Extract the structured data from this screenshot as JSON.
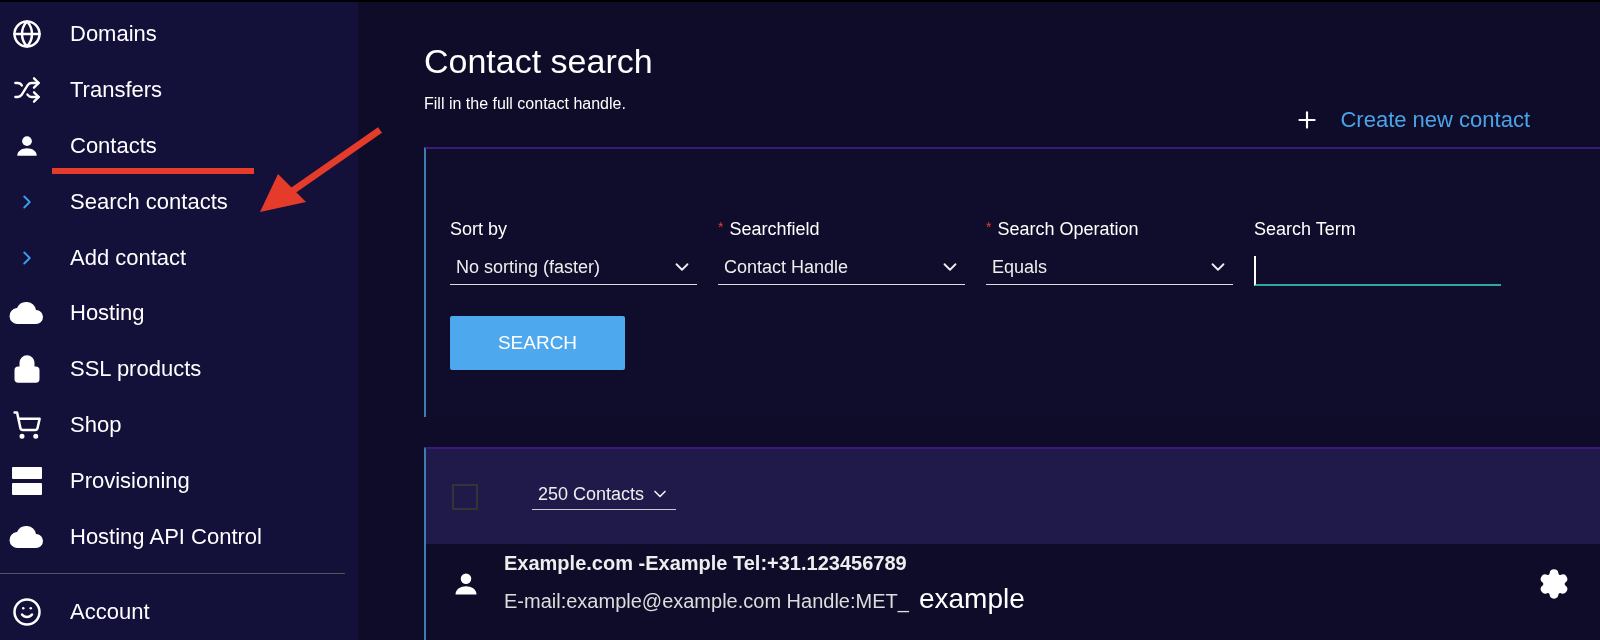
{
  "sidebar": {
    "items": [
      {
        "kind": "main",
        "label": "Domains",
        "underlined": false
      },
      {
        "kind": "main",
        "label": "Transfers",
        "underlined": false
      },
      {
        "kind": "main",
        "label": "Contacts",
        "underlined": true
      },
      {
        "kind": "sub",
        "label": "Search contacts",
        "underlined": false
      },
      {
        "kind": "sub",
        "label": "Add contact",
        "underlined": false
      },
      {
        "kind": "main",
        "label": "Hosting",
        "underlined": false
      },
      {
        "kind": "main",
        "label": "SSL products",
        "underlined": false
      },
      {
        "kind": "main",
        "label": "Shop",
        "underlined": false
      },
      {
        "kind": "main",
        "label": "Provisioning",
        "underlined": false
      },
      {
        "kind": "main",
        "label": "Hosting API Control",
        "underlined": false
      },
      {
        "kind": "divider"
      },
      {
        "kind": "main",
        "label": "Account",
        "underlined": false
      }
    ]
  },
  "page": {
    "title": "Contact search",
    "subtitle": "Fill in the full contact handle.",
    "create_link": "Create new contact"
  },
  "search_form": {
    "fields": [
      {
        "kind": "select",
        "label": "Sort by",
        "value": "No sorting (faster)"
      },
      {
        "kind": "select",
        "label": "Searchfield",
        "required_mark": "*",
        "value": "Contact Handle"
      },
      {
        "kind": "select",
        "label": "Search Operation",
        "required_mark": "*",
        "value": "Equals"
      },
      {
        "kind": "text",
        "label": "Search Term",
        "focused": true
      }
    ],
    "button": "SEARCH"
  },
  "results": {
    "checked": false,
    "page_size": "250 Contacts",
    "rows": [
      {
        "title": "Example.com -Example Tel:+31.123456789",
        "detail": "E-mail:example@example.com Handle:MET_",
        "overlay_text": "example"
      }
    ]
  }
}
